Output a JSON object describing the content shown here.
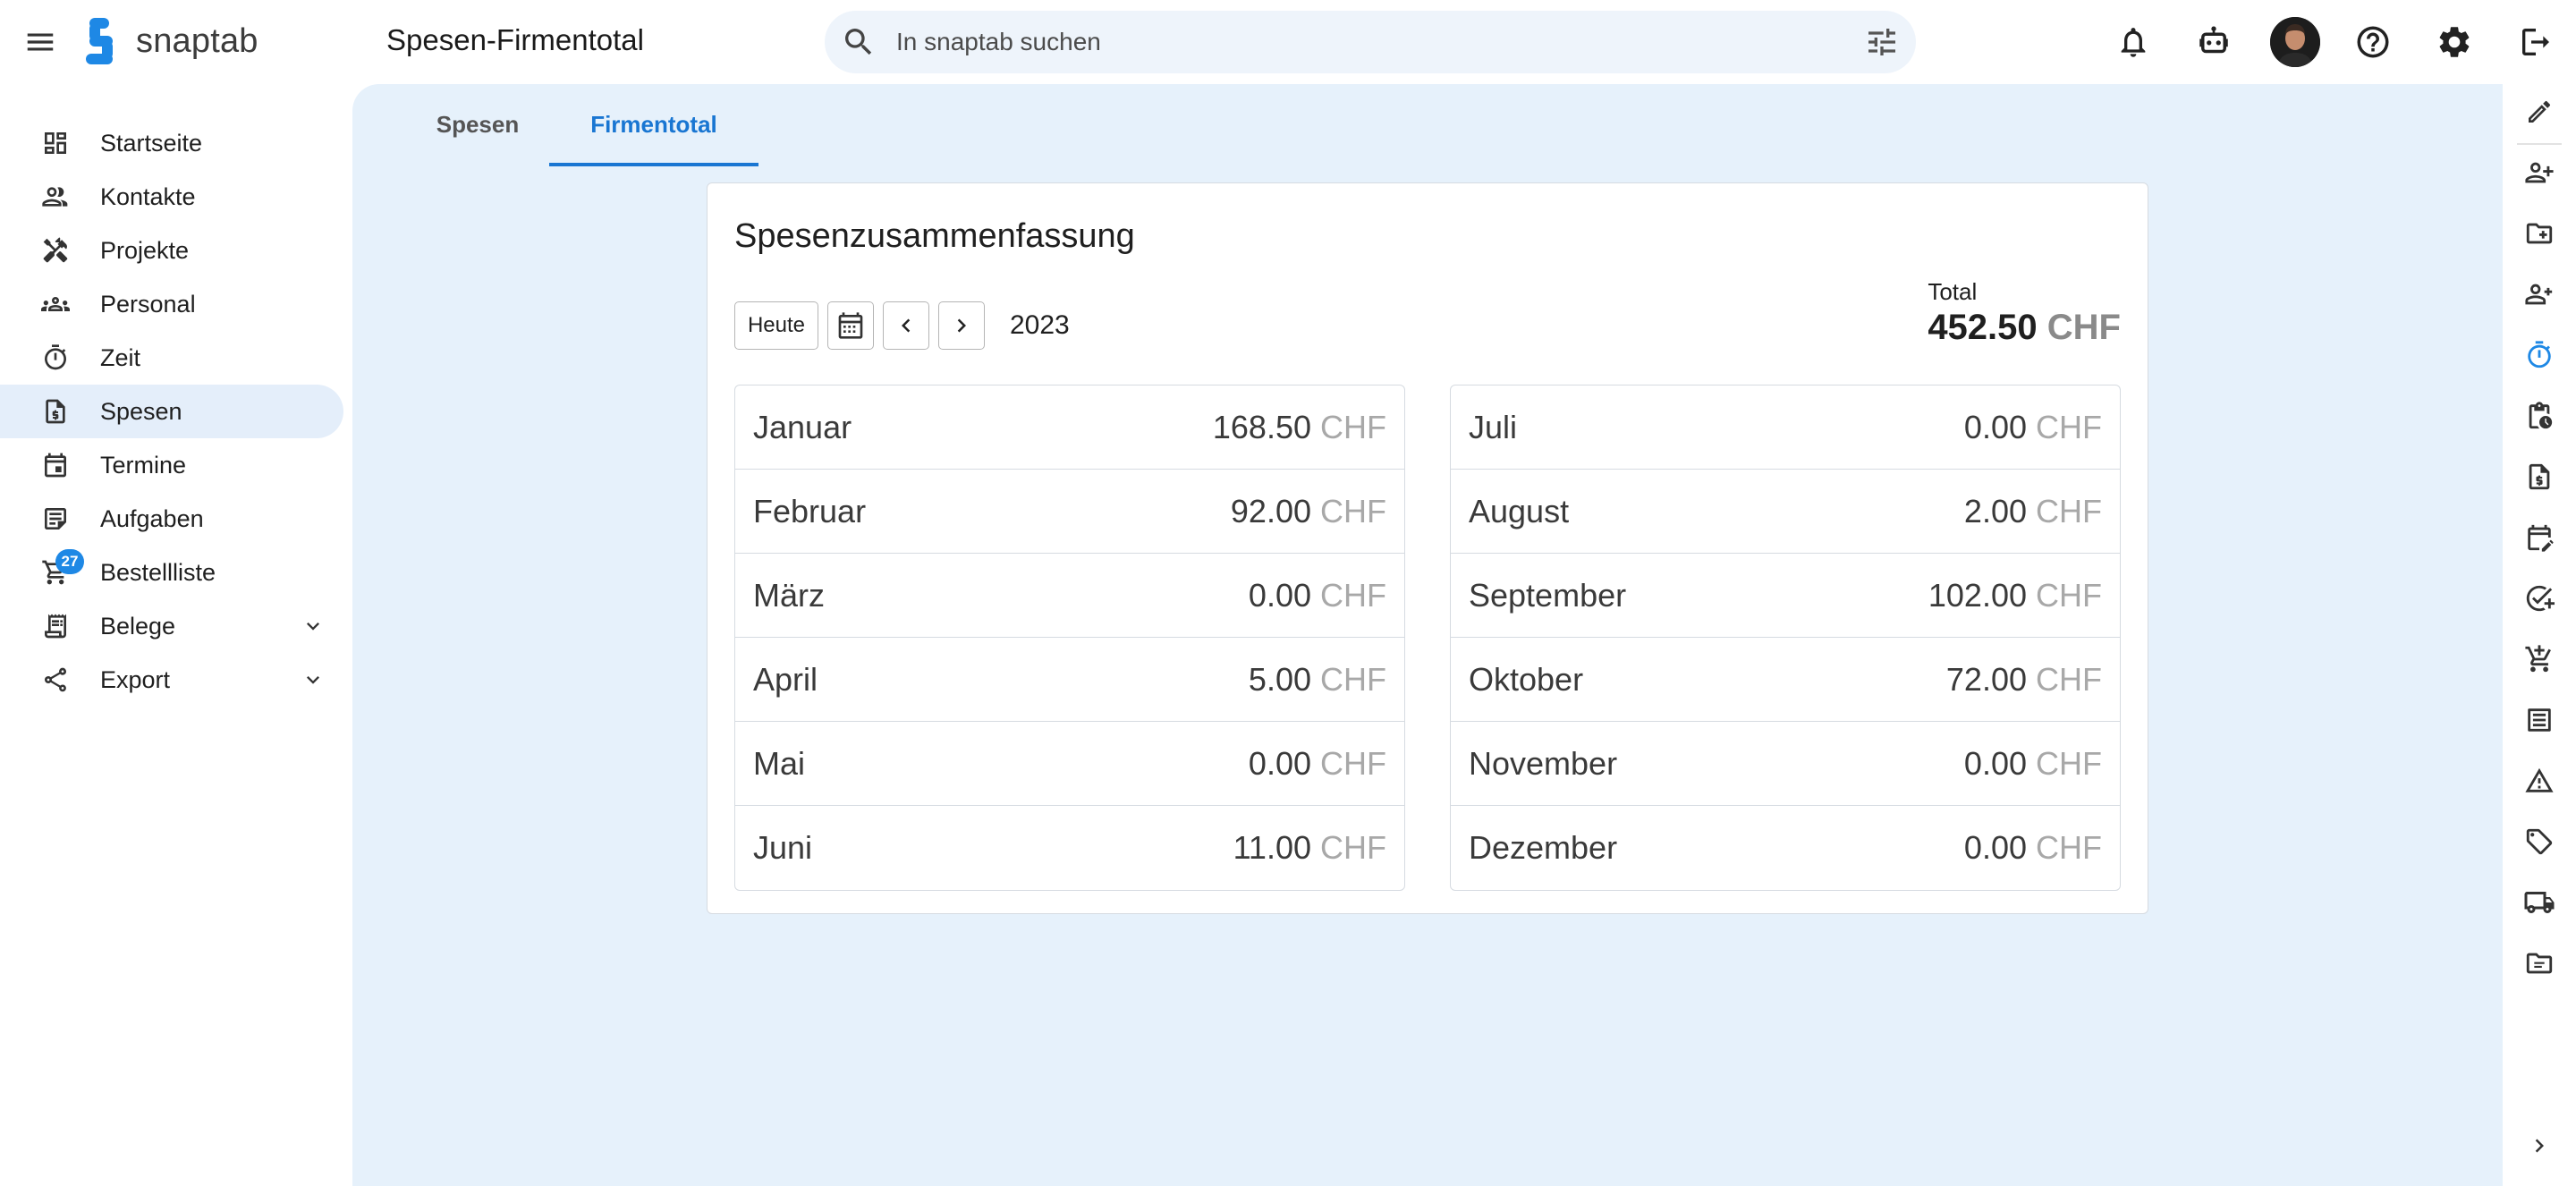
{
  "app": {
    "name": "snaptab",
    "page_title": "Spesen-Firmentotal",
    "brand_color": "#1e88e5"
  },
  "search": {
    "placeholder": "In snaptab suchen"
  },
  "header_icons": [
    "notifications-icon",
    "robot-icon",
    "avatar",
    "help-icon",
    "settings-icon",
    "logout-icon"
  ],
  "sidebar": {
    "items": [
      {
        "label": "Startseite",
        "icon": "dashboard-icon"
      },
      {
        "label": "Kontakte",
        "icon": "contacts-icon"
      },
      {
        "label": "Projekte",
        "icon": "tools-icon"
      },
      {
        "label": "Personal",
        "icon": "groups-icon"
      },
      {
        "label": "Zeit",
        "icon": "timer-icon"
      },
      {
        "label": "Spesen",
        "icon": "receipt-icon",
        "active": true
      },
      {
        "label": "Termine",
        "icon": "calendar-icon"
      },
      {
        "label": "Aufgaben",
        "icon": "tasks-icon"
      },
      {
        "label": "Bestellliste",
        "icon": "cart-icon",
        "badge": "27"
      },
      {
        "label": "Belege",
        "icon": "documents-icon",
        "expandable": true
      },
      {
        "label": "Export",
        "icon": "share-icon",
        "expandable": true
      }
    ]
  },
  "tabs": [
    {
      "label": "Spesen"
    },
    {
      "label": "Firmentotal",
      "active": true
    }
  ],
  "summary": {
    "title": "Spesenzusammenfassung",
    "today_label": "Heute",
    "year": "2023",
    "total_label": "Total",
    "total_value": "452.50",
    "currency": "CHF",
    "months_left": [
      {
        "name": "Januar",
        "amount": "168.50"
      },
      {
        "name": "Februar",
        "amount": "92.00"
      },
      {
        "name": "März",
        "amount": "0.00"
      },
      {
        "name": "April",
        "amount": "5.00"
      },
      {
        "name": "Mai",
        "amount": "0.00"
      },
      {
        "name": "Juni",
        "amount": "11.00"
      }
    ],
    "months_right": [
      {
        "name": "Juli",
        "amount": "0.00"
      },
      {
        "name": "August",
        "amount": "2.00"
      },
      {
        "name": "September",
        "amount": "102.00"
      },
      {
        "name": "Oktober",
        "amount": "72.00"
      },
      {
        "name": "November",
        "amount": "0.00"
      },
      {
        "name": "Dezember",
        "amount": "0.00"
      }
    ]
  },
  "right_rail_icons": [
    "edit-icon",
    "add-contact-icon",
    "add-folder-icon",
    "add-staff-icon",
    "timer-icon",
    "clipboard-clock-icon",
    "receipt-icon",
    "calendar-edit-icon",
    "task-add-icon",
    "cart-add-icon",
    "list-icon",
    "warning-icon",
    "tag-icon",
    "truck-icon",
    "folder-list-icon",
    "chevron-right-icon"
  ]
}
